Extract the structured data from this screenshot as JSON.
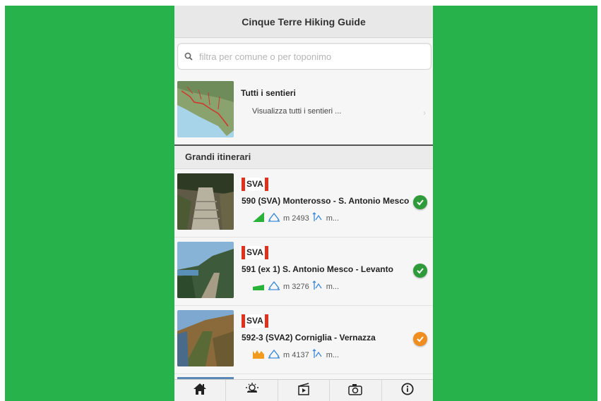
{
  "header": {
    "title": "Cinque Terre Hiking Guide"
  },
  "search": {
    "placeholder": "filtra per comune o per toponimo",
    "value": "",
    "icon": "search-icon"
  },
  "all_trails": {
    "title": "Tutti i sentieri",
    "description": "Visualizza tutti i sentieri ..."
  },
  "section": {
    "title": "Grandi itinerari"
  },
  "trails": [
    {
      "badge": "SVA",
      "title": "590 (SVA) Monterosso - S. Antonio Mesco",
      "distance": "m 2493",
      "elevation": "m...",
      "difficulty": "easy",
      "status": "done",
      "status_color": "#2e9a3a"
    },
    {
      "badge": "SVA",
      "title": "591 (ex 1) S. Antonio Mesco - Levanto",
      "distance": "m 3276",
      "elevation": "m...",
      "difficulty": "medium",
      "status": "done",
      "status_color": "#2e9a3a"
    },
    {
      "badge": "SVA",
      "title": "592-3 (SVA2) Corniglia - Vernazza",
      "distance": "m 4137",
      "elevation": "m...",
      "difficulty": "hard",
      "status": "warning",
      "status_color": "#ef8d1f"
    }
  ],
  "tabs": [
    {
      "name": "home-icon"
    },
    {
      "name": "weather-icon"
    },
    {
      "name": "film-icon"
    },
    {
      "name": "camera-icon"
    },
    {
      "name": "info-icon"
    }
  ],
  "colors": {
    "background": "#27b24b",
    "badge": "#e0301e",
    "easy": "#29b23a",
    "hard": "#f29a1e",
    "check_green": "#2e9a3a",
    "check_orange": "#ef8d1f"
  }
}
